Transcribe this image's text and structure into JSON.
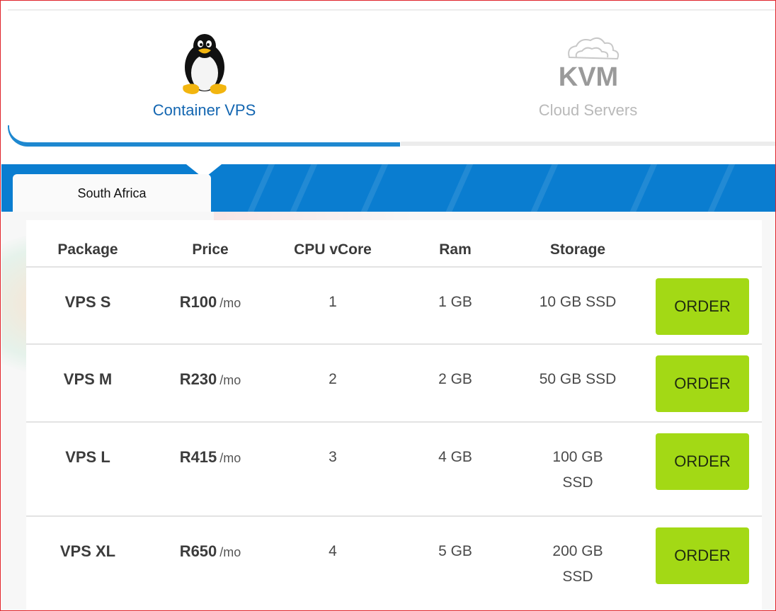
{
  "product_tabs": [
    {
      "label": "Container VPS",
      "icon": "linux-penguin-icon",
      "active": true
    },
    {
      "label": "Cloud Servers",
      "icon": "kvm-cloud-icon",
      "logo_text": "KVM",
      "active": false
    }
  ],
  "region_tab": {
    "label": "South Africa"
  },
  "table": {
    "headers": [
      "Package",
      "Price",
      "CPU vCore",
      "Ram",
      "Storage"
    ],
    "rows": [
      {
        "package": "VPS S",
        "price": "R100",
        "unit": "/mo",
        "cpu": "1",
        "ram": "1 GB",
        "storage": "10 GB SSD",
        "action": "ORDER"
      },
      {
        "package": "VPS M",
        "price": "R230",
        "unit": "/mo",
        "cpu": "2",
        "ram": "2 GB",
        "storage": "50 GB SSD",
        "action": "ORDER"
      },
      {
        "package": "VPS L",
        "price": "R415",
        "unit": "/mo",
        "cpu": "3",
        "ram": "4 GB",
        "storage_line1": "100 GB",
        "storage_line2": "SSD",
        "action": "ORDER"
      },
      {
        "package": "VPS XL",
        "price": "R650",
        "unit": "/mo",
        "cpu": "4",
        "ram": "5 GB",
        "storage_line1": "200 GB",
        "storage_line2": "SSD",
        "action": "ORDER"
      }
    ]
  },
  "colors": {
    "accent_blue": "#1e88d0",
    "band_blue": "#0a7dd0",
    "order_green": "#a3d915",
    "frame_red": "#e0242a"
  }
}
